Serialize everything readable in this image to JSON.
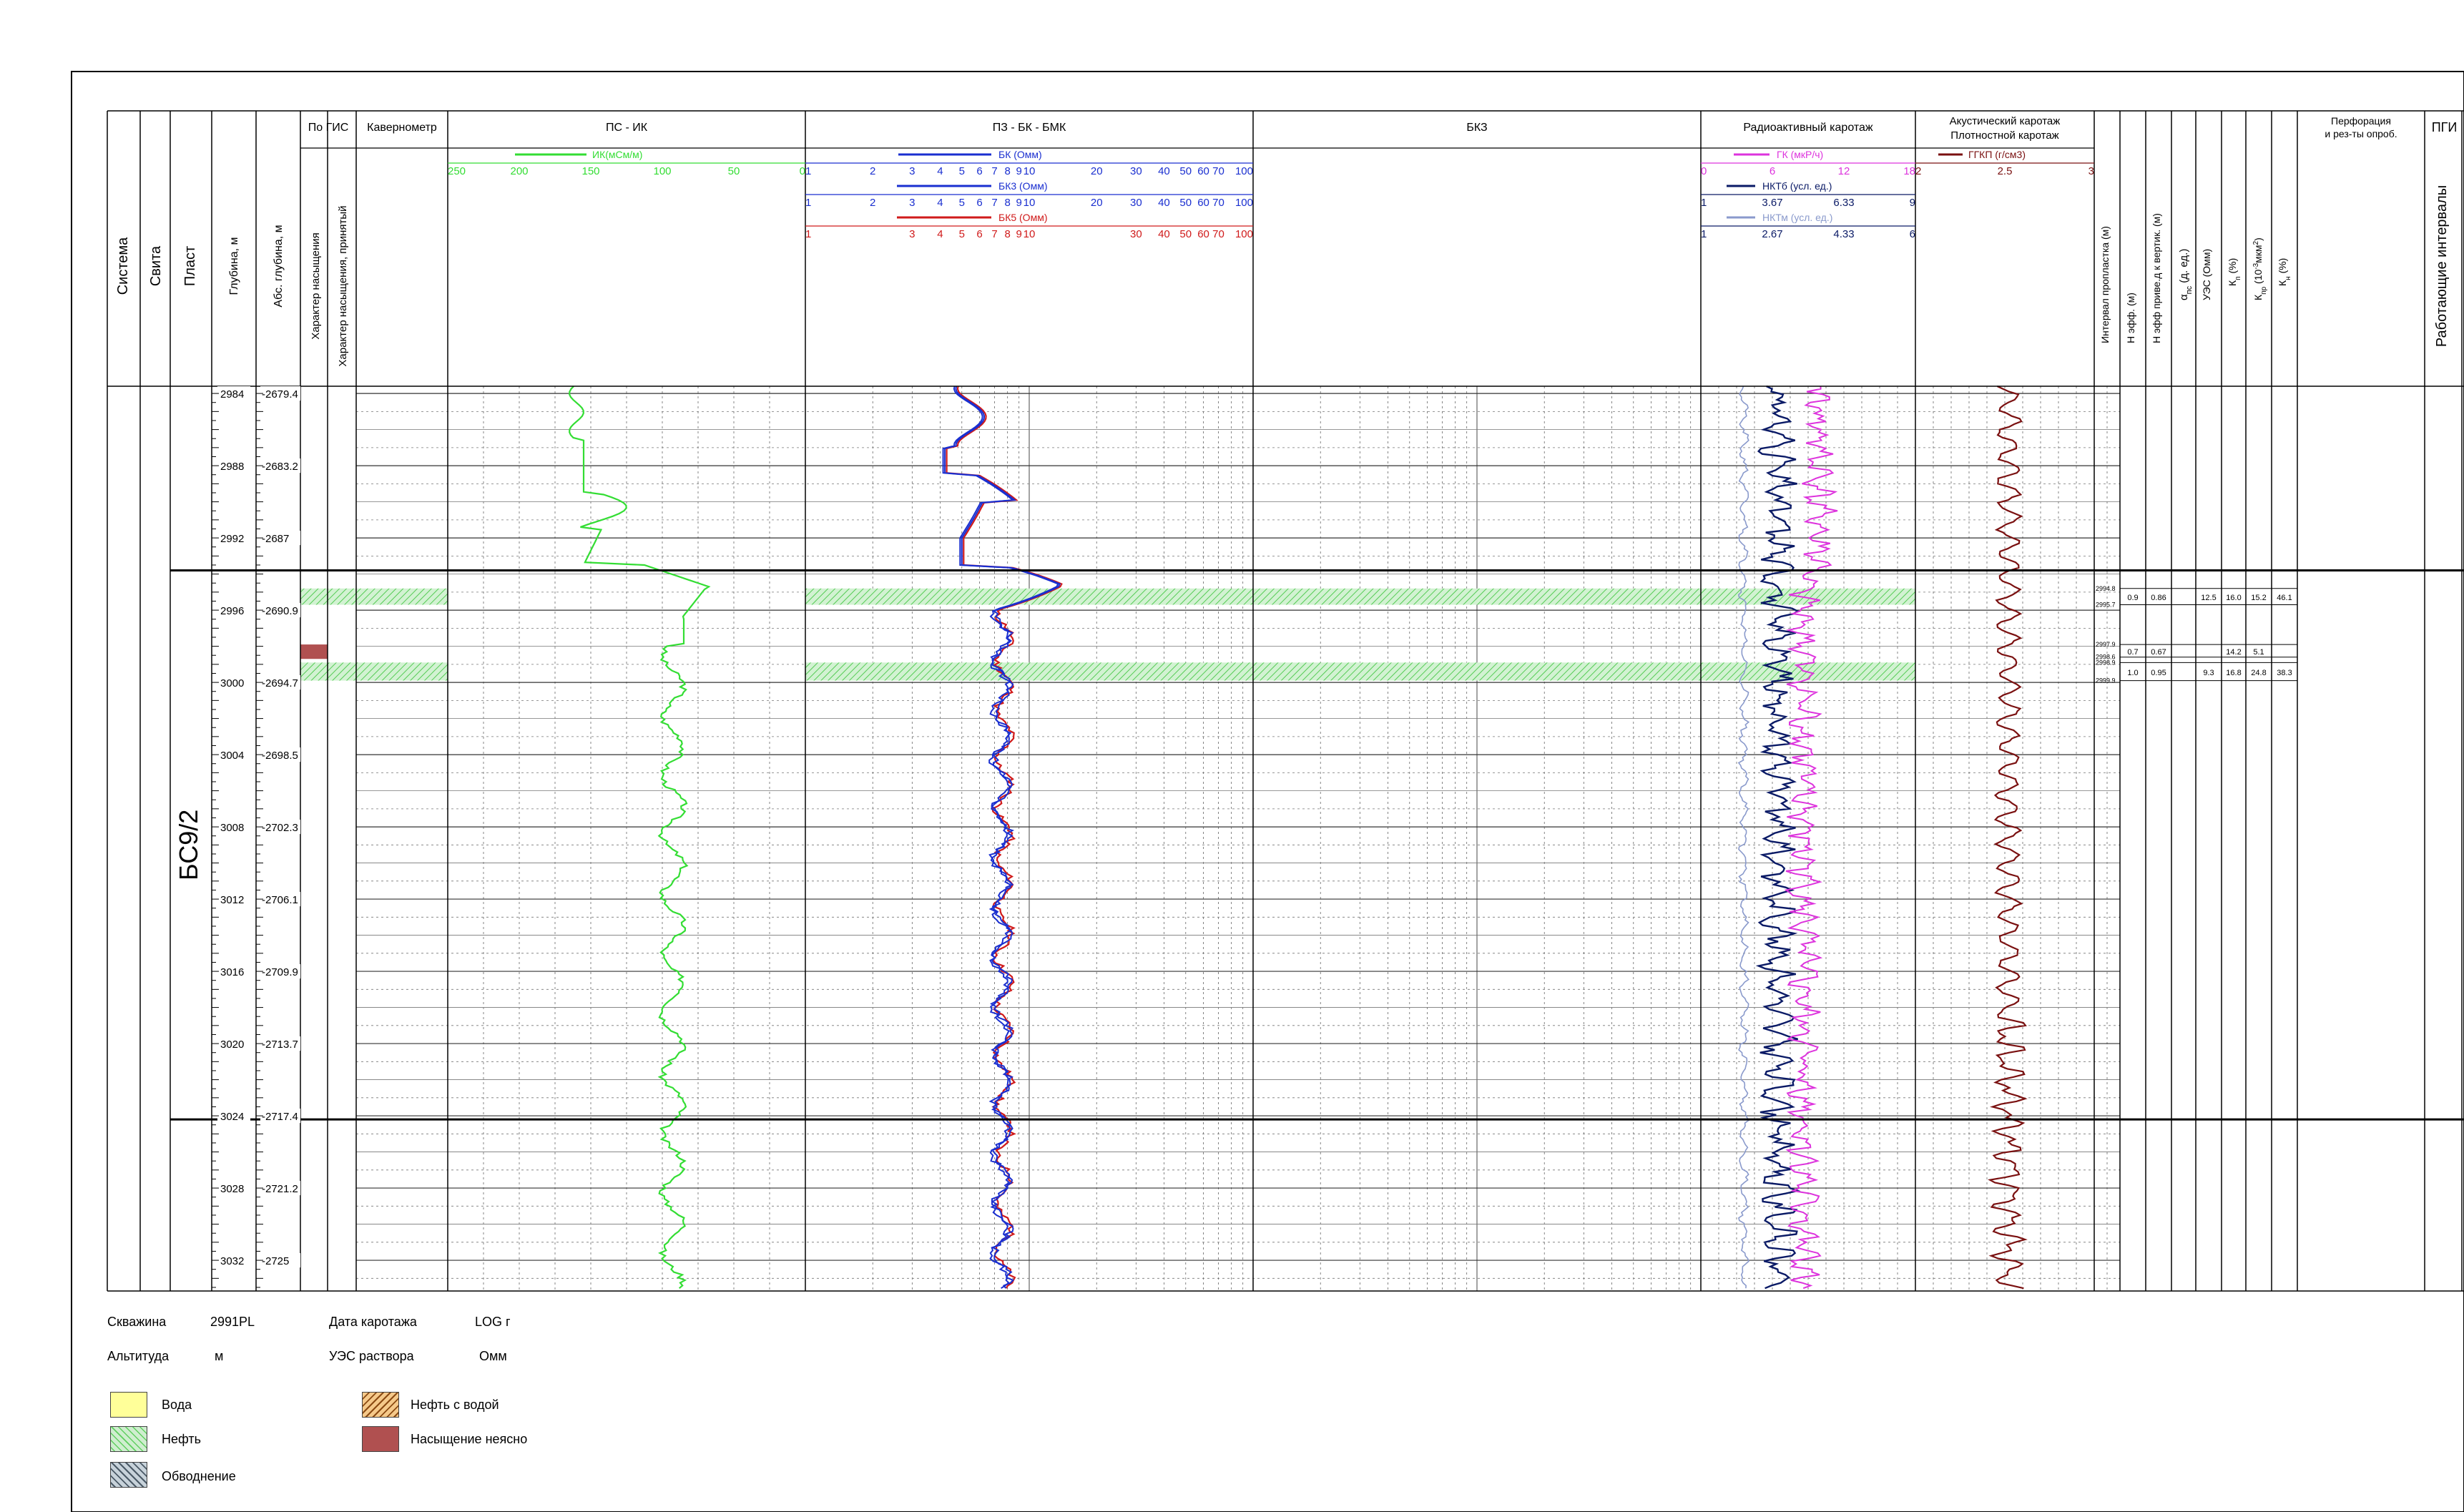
{
  "columns": {
    "system": "Система",
    "suite": "Свита",
    "layer": "Пласт",
    "depth": "Глубина, м",
    "abs_depth": "Абс. глубина, м",
    "by_gis": "По ГИС",
    "sat_char": "Характер насыщения",
    "sat_char_accepted": "Характер насыщения, принятый",
    "caliper": "Кавернометр",
    "ps_ik": "ПС - ИК",
    "pz_bk": "ПЗ - БК - БМК",
    "bkz": "БКЗ",
    "radio": "Радиоактивный каротаж",
    "acoustic1": "Акустический каротаж",
    "acoustic2": "Плотностной каротаж",
    "interval": "Интервал пропластка (м)",
    "h_eff": "Н эфф. (м)",
    "h_eff_vert": "Н эфф приве.д к вертик. (м)",
    "alpha": "α",
    "alpha_sub": "пс",
    "alpha_rest": " (д. ед.)",
    "ues": "УЭС (Омм)",
    "kp": "К",
    "kp_sub": "п",
    "kp_unit": " (%)",
    "kpr": "К",
    "kpr_sub": "пр",
    "kpr_unit": " (10",
    "kpr_sup": "-3",
    "kpr_unit2": "мкм",
    "kpr_sup2": "2",
    "kpr_close": ")",
    "kn": "К",
    "kn_sub": "н",
    "kn_unit": " (%)",
    "perf1": "Перфорация",
    "perf2": "и рез-ты опроб.",
    "pgi": "ПГИ",
    "working": "Работающие интервалы"
  },
  "scales": {
    "ik_label": "ИК(мСм/м)",
    "ik_ticks": [
      "250",
      "200",
      "150",
      "100",
      "50",
      "0"
    ],
    "bk_label": "БК (Омм)",
    "bk3_label": "БК3 (Омм)",
    "bk5_label": "БК5 (Омм)",
    "log_ticks": [
      "1",
      "2",
      "3",
      "4",
      "5",
      "6",
      "7",
      "8",
      "9",
      "10",
      "20",
      "30",
      "40",
      "50",
      "60",
      "70",
      "100"
    ],
    "gk_label": "ГК (мкР/ч)",
    "gk_ticks": [
      "0",
      "6",
      "12",
      "18"
    ],
    "nkt_label": "НКТб (усл. ед.)",
    "nkt_ticks": [
      "1",
      "3.67",
      "6.33",
      "9"
    ],
    "nktm_label": "НКТм (усл. ед.)",
    "nktm_ticks": [
      "1",
      "2.67",
      "4.33",
      "6"
    ],
    "ggkp_label": "ГГКП (г/см3)",
    "ggkp_ticks": [
      "2",
      "2.5",
      "3"
    ]
  },
  "depth_range": [
    2983.6,
    3033.7
  ],
  "depth_rows": [
    {
      "md": "2984",
      "abs": "-2679.4"
    },
    {
      "md": "2988",
      "abs": "-2683.2"
    },
    {
      "md": "2992",
      "abs": "-2687"
    },
    {
      "md": "2996",
      "abs": "-2690.9"
    },
    {
      "md": "3000",
      "abs": "-2694.7"
    },
    {
      "md": "3004",
      "abs": "-2698.5"
    },
    {
      "md": "3008",
      "abs": "-2702.3"
    },
    {
      "md": "3012",
      "abs": "-2706.1"
    },
    {
      "md": "3016",
      "abs": "-2709.9"
    },
    {
      "md": "3020",
      "abs": "-2713.7"
    },
    {
      "md": "3024",
      "abs": "-2717.4"
    },
    {
      "md": "3028",
      "abs": "-2721.2"
    },
    {
      "md": "3032",
      "abs": "-2725"
    }
  ],
  "layer_name": "БС9/2",
  "layer_top": 2993.8,
  "layer_bottom": 3024.2,
  "saturation_intervals": [
    {
      "top": 2994.8,
      "bottom": 2995.7,
      "type": "oil"
    },
    {
      "top": 2997.9,
      "bottom": 2998.7,
      "type": "unclear"
    },
    {
      "top": 2998.9,
      "bottom": 2999.9,
      "type": "oil"
    }
  ],
  "results": [
    {
      "top": "2994.8",
      "bottom": "2995.7",
      "h_eff": "0.9",
      "h_vert": "0.86",
      "ues": "12.5",
      "kp": "16.0",
      "kpr": "15.2",
      "kn": "46.1",
      "y": 2995.25
    },
    {
      "top": "2997.9",
      "bottom": "2998.6",
      "h_eff": "0.7",
      "h_vert": "0.67",
      "ues": "",
      "kp": "14.2",
      "kpr": "5.1",
      "kn": "",
      "y": 2998.25
    },
    {
      "top": "2998.9",
      "bottom": "2999.9",
      "h_eff": "1.0",
      "h_vert": "0.95",
      "ues": "9.3",
      "kp": "16.8",
      "kpr": "24.8",
      "kn": "38.3",
      "y": 2999.4
    }
  ],
  "footer": {
    "well_label": "Скважина",
    "well_value": "2991PL",
    "date_label": "Дата каротажа",
    "date_value": "LOG г",
    "alt_label": "Альтитуда",
    "alt_unit": "м",
    "mud_label": "УЭС раствора",
    "mud_unit": "Омм"
  },
  "legend": [
    {
      "label": "Вода",
      "type": "water"
    },
    {
      "label": "Нефть",
      "type": "oil"
    },
    {
      "label": "Обводнение",
      "type": "flood"
    },
    {
      "label": "Нефть с водой",
      "type": "oilwater"
    },
    {
      "label": "Насыщение неясно",
      "type": "unclear"
    }
  ],
  "colors": {
    "ik": "#33dd33",
    "bk": "#1a2fd0",
    "bk3": "#1a2fd0",
    "bk5": "#d01a1a",
    "gk": "#dd33dd",
    "nkt": "#0a1a66",
    "nktm": "#8a9acc",
    "ggkp": "#7a1010",
    "unclear": "#b05050"
  }
}
